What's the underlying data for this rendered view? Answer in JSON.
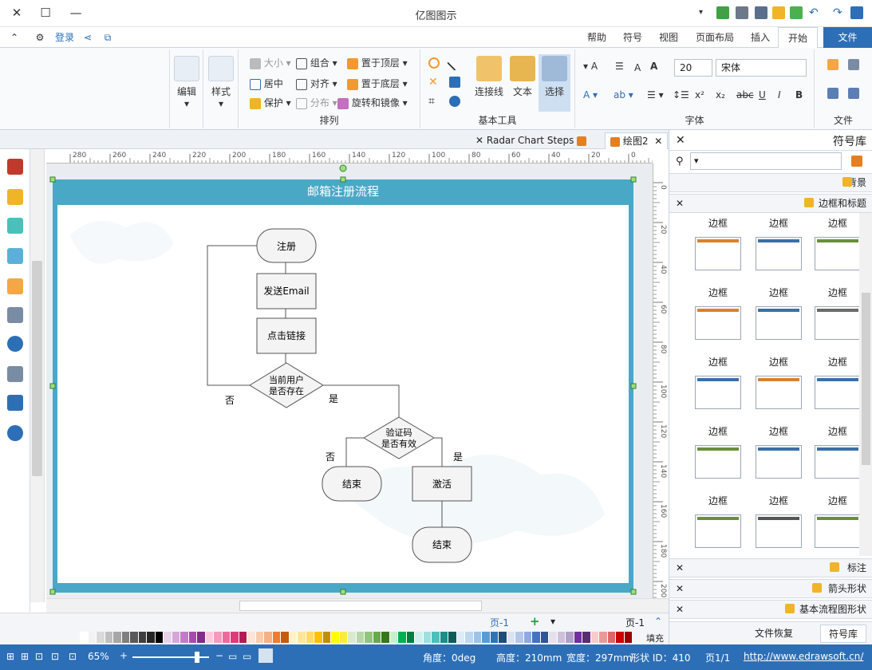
{
  "app_title": "亿图图示",
  "ribbon_tabs": [
    "文件",
    "开始",
    "插入",
    "页面布局",
    "视图",
    "符号",
    "帮助"
  ],
  "account": {
    "login": "登录"
  },
  "ribbon": {
    "file_group": {
      "label": "文件"
    },
    "font_group": {
      "label": "字体",
      "font_name": "宋体",
      "font_size": "20"
    },
    "basic_tools": {
      "label": "基本工具",
      "select": "选择",
      "text": "文本",
      "connector": "连接线"
    },
    "arrange": {
      "label": "排列",
      "bring_front": "置于顶层",
      "send_back": "置于底层",
      "rotate_mirror": "旋转和镜像",
      "group": "组合",
      "align": "对齐",
      "distribute": "分布",
      "size": "大小",
      "center": "居中",
      "protect": "保护"
    },
    "style_btn": "样式",
    "edit_btn": "编辑"
  },
  "doc_tabs": [
    {
      "label": "绘图2"
    },
    {
      "label": "Radar Chart Steps"
    }
  ],
  "ruler": {
    "h_ticks": [
      "280",
      "260",
      "240",
      "220",
      "200",
      "180",
      "160",
      "140",
      "120",
      "100",
      "80",
      "60",
      "40",
      "20",
      "0"
    ],
    "v_ticks": [
      "0",
      "20",
      "40",
      "60",
      "80",
      "100",
      "120",
      "140",
      "160",
      "180",
      "200"
    ]
  },
  "diagram": {
    "title": "邮箱注册流程",
    "nodes": {
      "register": "注册",
      "send_email": "发送Email",
      "click_link": "点击链接",
      "user_exists": "当前用户\n是否存在",
      "verify": "验证码\n是否有效",
      "end1": "结束",
      "activate": "激活",
      "end2": "结束"
    },
    "labels": {
      "no1": "否",
      "yes1": "是",
      "no2": "否",
      "yes2": "是"
    }
  },
  "pages": {
    "current": "页-1",
    "tab": "页-1"
  },
  "fill_label": "填充",
  "palette_colors": [
    "#ffffff",
    "#f2f2f2",
    "#d9d9d9",
    "#bfbfbf",
    "#a6a6a6",
    "#7f7f7f",
    "#595959",
    "#3f3f3f",
    "#262626",
    "#000000",
    "#e7d2e8",
    "#d5a6d8",
    "#c17cc7",
    "#a74aae",
    "#7d2e85",
    "#f8cbdc",
    "#f39bbc",
    "#ec6b9c",
    "#e2397b",
    "#b01d56",
    "#fce4d6",
    "#f8cbad",
    "#f4b183",
    "#ed7d31",
    "#c55a11",
    "#fff2cc",
    "#ffe699",
    "#ffd966",
    "#ffc000",
    "#bf9000",
    "#ffff00",
    "#ffeb3b",
    "#d9ead3",
    "#b6d7a8",
    "#93c47d",
    "#6aa84f",
    "#38761d",
    "#c6efce",
    "#00b050",
    "#007f3f",
    "#d0f0ef",
    "#9fdfdd",
    "#4bc0bb",
    "#1c8d88",
    "#0e5c58",
    "#ddebf7",
    "#bdd7ee",
    "#9dc3e6",
    "#5b9bd5",
    "#2e75b6",
    "#1f4e79",
    "#dae3f3",
    "#b4c7e7",
    "#8faadc",
    "#4472c4",
    "#2f5597",
    "#e6e0ec",
    "#ccc0da",
    "#b1a0c7",
    "#7030a0",
    "#5b2c6f",
    "#f4cccc",
    "#ea9999",
    "#e06666",
    "#cc0000",
    "#990000"
  ],
  "status": {
    "url": "http://www.edrawsoft.cn/",
    "page_info": "页1/1",
    "shape_id": "形状 ID：410",
    "width": "宽度：297mm",
    "height": "高度：210mm",
    "angle": "角度：0deg",
    "zoom": "65%"
  },
  "symbol_library": {
    "title": "符号库",
    "search_placeholder": "",
    "categories": {
      "background": "背景",
      "borders_titles": "边框和标题",
      "annotations": "标注",
      "arrows": "箭头形状",
      "basic_flow": "基本流程图形状"
    },
    "thumb_label": "边框",
    "thumb_colors": [
      [
        "#6a8f3a",
        "#3d6ea8",
        "#d9822b"
      ],
      [
        "#6b6b6b",
        "#3d6ea8",
        "#d9822b"
      ],
      [
        "#3d6ea8",
        "#d9822b",
        "#3d6ea8"
      ],
      [
        "#3d6ea8",
        "#3d6ea8",
        "#6a8f3a"
      ],
      [
        "#6a8f3a",
        "#555555",
        "#6a8f3a"
      ]
    ]
  },
  "bottom_tabs": {
    "symbol": "符号库",
    "file_recovery": "文件恢复"
  }
}
